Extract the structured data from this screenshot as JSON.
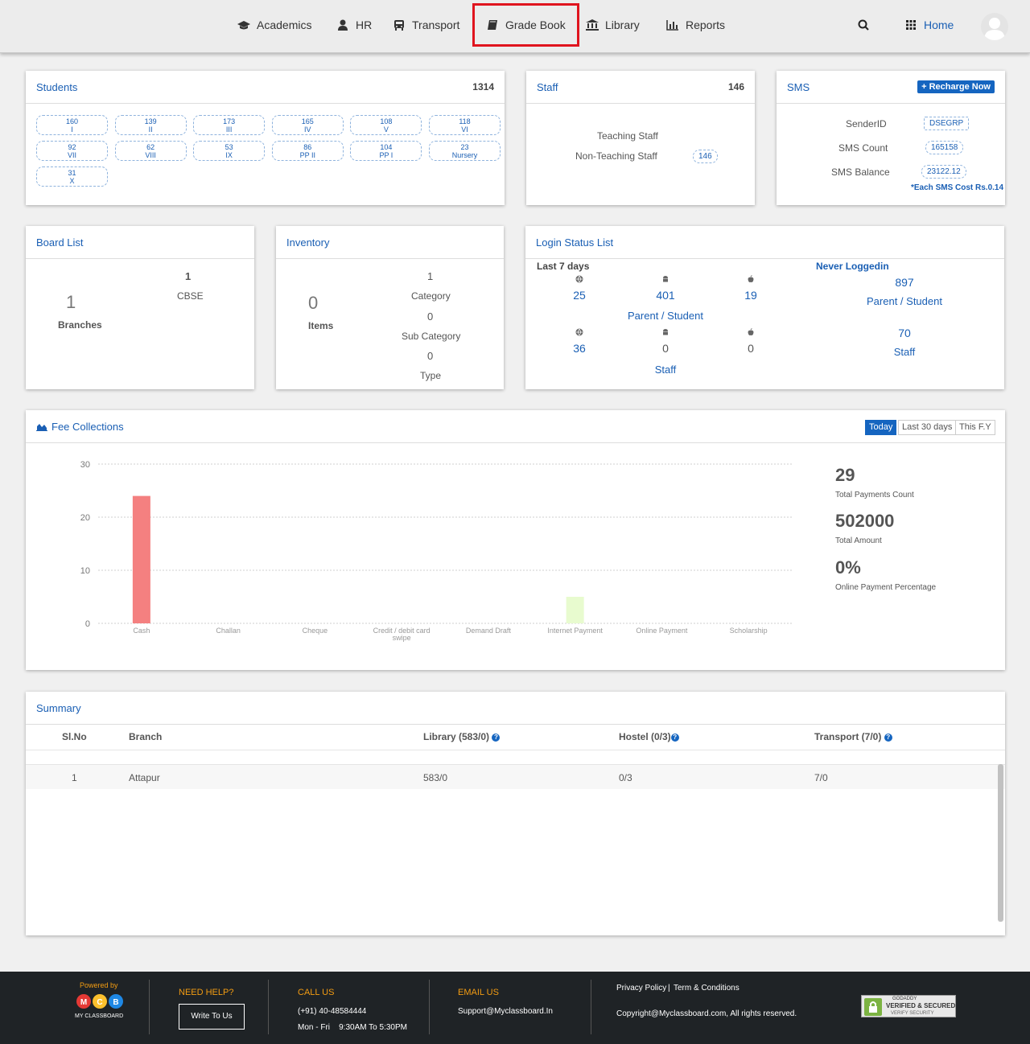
{
  "nav": {
    "items": [
      {
        "label": "Academics",
        "icon": "graduation-cap-icon"
      },
      {
        "label": "HR",
        "icon": "user-icon"
      },
      {
        "label": "Transport",
        "icon": "bus-icon"
      },
      {
        "label": "Grade Book",
        "icon": "book-icon"
      },
      {
        "label": "Library",
        "icon": "bank-icon"
      },
      {
        "label": "Reports",
        "icon": "bar-chart-icon"
      }
    ],
    "home_label": "Home"
  },
  "students": {
    "title": "Students",
    "total": "1314",
    "classes": [
      {
        "count": "160",
        "name": "I"
      },
      {
        "count": "139",
        "name": "II"
      },
      {
        "count": "173",
        "name": "III"
      },
      {
        "count": "165",
        "name": "IV"
      },
      {
        "count": "108",
        "name": "V"
      },
      {
        "count": "118",
        "name": "VI"
      },
      {
        "count": "92",
        "name": "VII"
      },
      {
        "count": "62",
        "name": "VIII"
      },
      {
        "count": "53",
        "name": "IX"
      },
      {
        "count": "86",
        "name": "PP II"
      },
      {
        "count": "104",
        "name": "PP I"
      },
      {
        "count": "23",
        "name": "Nursery"
      },
      {
        "count": "31",
        "name": "X"
      }
    ]
  },
  "staff": {
    "title": "Staff",
    "total": "146",
    "teaching_label": "Teaching Staff",
    "non_teaching_label": "Non-Teaching Staff",
    "non_teaching_value": "146"
  },
  "sms": {
    "title": "SMS",
    "recharge_label": "Recharge Now",
    "sender_id_label": "SenderID",
    "sender_id": "DSEGRP",
    "count_label": "SMS Count",
    "count": "165158",
    "balance_label": "SMS Balance",
    "balance": "23122.12",
    "cost_note": "*Each SMS Cost Rs.0.14"
  },
  "board_list": {
    "title": "Board List",
    "branches_value": "1",
    "branches_label": "Branches",
    "cbse_value": "1",
    "cbse_label": "CBSE"
  },
  "inventory": {
    "title": "Inventory",
    "items_value": "0",
    "items_label": "Items",
    "category_value": "1",
    "category_label": "Category",
    "subcategory_value": "0",
    "subcategory_label": "Sub Category",
    "type_value": "0",
    "type_label": "Type"
  },
  "login_status": {
    "title": "Login Status List",
    "last7_label": "Last 7 days",
    "never_label": "Never Loggedin",
    "parent_web": "25",
    "parent_android": "401",
    "parent_ios": "19",
    "parent_label": "Parent / Student",
    "staff_web": "36",
    "staff_android": "0",
    "staff_ios": "0",
    "staff_label": "Staff",
    "never_parent": "897",
    "never_parent_label": "Parent / Student",
    "never_staff": "70",
    "never_staff_label": "Staff"
  },
  "fee": {
    "title": "Fee Collections",
    "periods": [
      "Today",
      "Last 30 days",
      "This F.Y"
    ],
    "total_count": "29",
    "total_count_label": "Total Payments Count",
    "total_amount": "502000",
    "total_amount_label": "Total Amount",
    "online_pct": "0%",
    "online_pct_label": "Online Payment Percentage"
  },
  "chart_data": {
    "type": "bar",
    "categories": [
      "Cash",
      "Challan",
      "Cheque",
      "Credit / debit card swipe",
      "Demand Draft",
      "Internet Payment",
      "Online Payment",
      "Scholarship"
    ],
    "values": [
      24,
      0,
      0,
      0,
      0,
      5,
      0,
      0
    ],
    "colors": [
      "#f48080",
      "#f48080",
      "#f48080",
      "#f48080",
      "#f48080",
      "#e8fbcf",
      "#f48080",
      "#f48080"
    ],
    "yticks": [
      "30",
      "20",
      "10",
      "0"
    ],
    "ylim": [
      0,
      30
    ],
    "grid": true
  },
  "summary": {
    "title": "Summary",
    "headers": {
      "slno": "Sl.No",
      "branch": "Branch",
      "library": "Library (583/0)",
      "hostel": "Hostel (0/3)",
      "transport": "Transport (7/0)"
    },
    "rows": [
      {
        "slno": "1",
        "branch": "Attapur",
        "library": "583/0",
        "hostel": "0/3",
        "transport": "7/0"
      }
    ]
  },
  "footer": {
    "powered_by": "Powered by",
    "brand": "MY CLASSBOARD",
    "need_help": "NEED HELP?",
    "write_to_us": "Write To Us",
    "call_us": "CALL US",
    "phone": "(+91) 40-48584444",
    "hours": "Mon - Fri    9:30AM To 5:30PM",
    "email_us": "EMAIL US",
    "email": "Support@Myclassboard.In",
    "privacy": "Privacy Policy",
    "terms": "Term & Conditions",
    "copyright": "Copyright@Myclassboard.com, All rights reserved.",
    "badge_top": "GODADDY",
    "badge_main": "VERIFIED & SECURED",
    "badge_sub": "VERIFY SECURITY"
  }
}
